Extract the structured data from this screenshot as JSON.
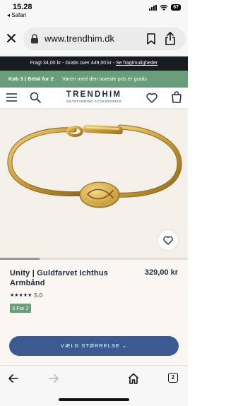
{
  "status": {
    "time": "15.28",
    "back_app": "◂ Safari",
    "battery": "67"
  },
  "browser": {
    "url": "www.trendhim.dk"
  },
  "shipping_banner": {
    "text": "Fragt 34,00 kr - Gratis over 449,00 kr - ",
    "link": "Se fragtmuligheder"
  },
  "promo_banner": {
    "title": "Køb 3 | Betal for 2",
    "text": "Varen med den laveste pris er gratis"
  },
  "header": {
    "brand": "TRENDHIM",
    "tagline": "OUTSTANDING ACCESSORIES"
  },
  "gallery": {
    "progress": 0.21
  },
  "product": {
    "title": "Unity | Guldfarvet Ichthus Armbånd",
    "price": "329,00 kr",
    "stars": "★★★★★",
    "rating": "5.0",
    "badge": "3 For 2"
  },
  "cta": {
    "label": "VÆLG STØRRELSE"
  },
  "toolbar": {
    "tab_count": "2"
  },
  "colors": {
    "promo_green": "#6a9e7b",
    "cta_blue": "#3d5a90",
    "dark_bar": "#161c22"
  }
}
